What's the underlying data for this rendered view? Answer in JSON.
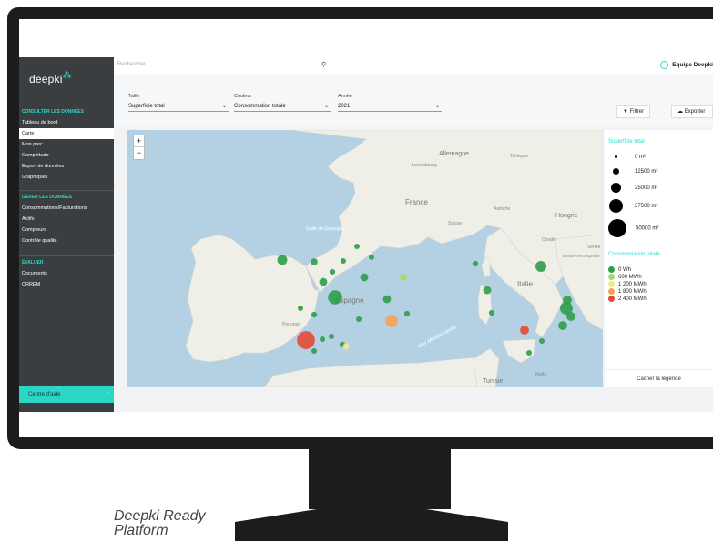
{
  "caption": [
    "Deepki Ready",
    "Platform"
  ],
  "app": {
    "logo": "deepki",
    "search_placeholder": "Rechercher",
    "team_label": "Equipe Deepki"
  },
  "sidebar": {
    "sections": [
      {
        "title": "CONSULTER LES DONNÉES",
        "items": [
          "Tableau de bord",
          "Carte",
          "Mon parc",
          "Complétude",
          "Export de données",
          "Graphiques"
        ]
      },
      {
        "title": "GÉRER LES DONNÉES",
        "items": [
          "Consommations/Facturations",
          "Actifs",
          "Compteurs",
          "Contrôle qualité"
        ]
      },
      {
        "title": "ÉVALUER",
        "items": [
          "Documents",
          "CRREM"
        ]
      }
    ],
    "active_item": "Carte",
    "help_button": "Centre d'aide"
  },
  "filters": {
    "size": {
      "label": "Taille",
      "value": "Superficie total"
    },
    "color": {
      "label": "Couleur",
      "value": "Consommation totale"
    },
    "year": {
      "label": "Année",
      "value": "2021"
    },
    "filter_button": "Filtrer",
    "export_button": "Exporter"
  },
  "map": {
    "labels": {
      "allemagne": "Allemagne",
      "luxembourg": "Luxembourg",
      "france": "France",
      "tcheque": "Tchéquie",
      "hongrie": "Hongrie",
      "croatie": "Croatie",
      "bosnie": "Bosnie-Herzégovine",
      "serbie": "Serbie",
      "golfe": "Golfe de Gascogne",
      "espagne": "Espagne",
      "portugal": "Portugal",
      "italie": "Italie",
      "mer": "Mer Méditerranée",
      "tunisie": "Tunisie",
      "malte": "Malte",
      "suisse": "Suisse",
      "autriche": "Autriche"
    },
    "assets": [
      {
        "size_m2": 3000,
        "color": "#2e9e48"
      },
      {
        "size_m2": 3000,
        "color": "#2e9e48"
      },
      {
        "size_m2": 2000,
        "color": "#2e9e48"
      },
      {
        "size_m2": 12500,
        "color": "#2e9e48"
      },
      {
        "size_m2": 6000,
        "color": "#2e9e48"
      },
      {
        "size_m2": 4000,
        "color": "#2e9e48"
      },
      {
        "size_m2": 8000,
        "color": "#2e9e48"
      },
      {
        "size_m2": 6000,
        "color": "#a6d96a"
      },
      {
        "size_m2": 25000,
        "color": "#2e9e48"
      },
      {
        "size_m2": 8000,
        "color": "#2e9e48"
      },
      {
        "size_m2": 3000,
        "color": "#2e9e48"
      },
      {
        "size_m2": 4000,
        "color": "#2e9e48"
      },
      {
        "size_m2": 20000,
        "color": "#f4a259"
      },
      {
        "size_m2": 8000,
        "color": "#2e9e48"
      },
      {
        "size_m2": 4000,
        "color": "#2e9e48"
      },
      {
        "size_m2": 3000,
        "color": "#2e9e48"
      },
      {
        "size_m2": 2500,
        "color": "#2e9e48"
      },
      {
        "size_m2": 2000,
        "color": "#2e9e48"
      },
      {
        "size_m2": 4000,
        "color": "#2e9e48"
      },
      {
        "size_m2": 40000,
        "color": "#e24a33"
      },
      {
        "size_m2": 5000,
        "color": "#f7e58a"
      },
      {
        "size_m2": 3000,
        "color": "#2e9e48"
      },
      {
        "size_m2": 15000,
        "color": "#2e9e48"
      },
      {
        "size_m2": 8000,
        "color": "#2e9e48"
      },
      {
        "size_m2": 4000,
        "color": "#2e9e48"
      },
      {
        "size_m2": 10000,
        "color": "#e24a33"
      },
      {
        "size_m2": 10000,
        "color": "#2e9e48"
      },
      {
        "size_m2": 20000,
        "color": "#2e9e48"
      },
      {
        "size_m2": 10000,
        "color": "#2e9e48"
      },
      {
        "size_m2": 10000,
        "color": "#2e9e48"
      },
      {
        "size_m2": 3000,
        "color": "#2e9e48"
      },
      {
        "size_m2": 4000,
        "color": "#2e9e48"
      },
      {
        "size_m2": 2000,
        "color": "#2e9e48"
      }
    ]
  },
  "legend": {
    "size_title": "Superficie total",
    "sizes": [
      "0 m²",
      "12500 m²",
      "25000 m²",
      "37500 m²",
      "50000 m²"
    ],
    "color_title": "Consommation totale",
    "colors": [
      {
        "label": "0 Wh",
        "color": "#2e9e48"
      },
      {
        "label": "600 MWh",
        "color": "#a6d96a"
      },
      {
        "label": "1 200 MWh",
        "color": "#f7e58a"
      },
      {
        "label": "1 800 MWh",
        "color": "#f4a259"
      },
      {
        "label": "2 400 MWh",
        "color": "#e24a33"
      }
    ],
    "hide_button": "Cacher la légende"
  }
}
